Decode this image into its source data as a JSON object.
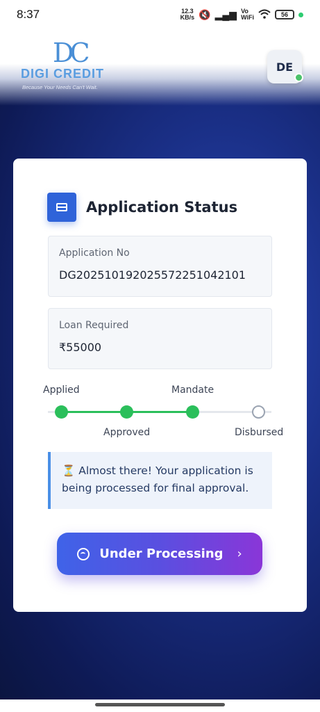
{
  "status_bar": {
    "time": "8:37",
    "net_speed_value": "12.3",
    "net_speed_unit": "KB/s",
    "battery": "56",
    "icons": [
      "mute-icon",
      "signal-icon",
      "vowifi-icon",
      "wifi-icon",
      "battery-icon"
    ]
  },
  "header": {
    "logo_mark": "DC",
    "logo_text": "DIGI CREDIT",
    "tagline": "Because Your Needs Can't Wait.",
    "avatar_initials": "DE"
  },
  "card": {
    "title": "Application Status",
    "application_no_label": "Application No",
    "application_no_value": "DG20251019202557225104​2101",
    "loan_label": "Loan Required",
    "loan_value": "₹55000"
  },
  "tracker": {
    "steps": [
      {
        "label": "Applied",
        "done": true
      },
      {
        "label": "Approved",
        "done": true
      },
      {
        "label": "Mandate",
        "done": true
      },
      {
        "label": "Disbursed",
        "done": false
      }
    ]
  },
  "note": {
    "text": "⏳ Almost there! Your application is being processed for final approval."
  },
  "action_button": {
    "label": "Under Processing",
    "chevron": "›"
  },
  "colors": {
    "accent_blue": "#2f63d9",
    "success_green": "#2bbf5b",
    "button_start": "#3f63e8",
    "button_end": "#8a36d8"
  }
}
